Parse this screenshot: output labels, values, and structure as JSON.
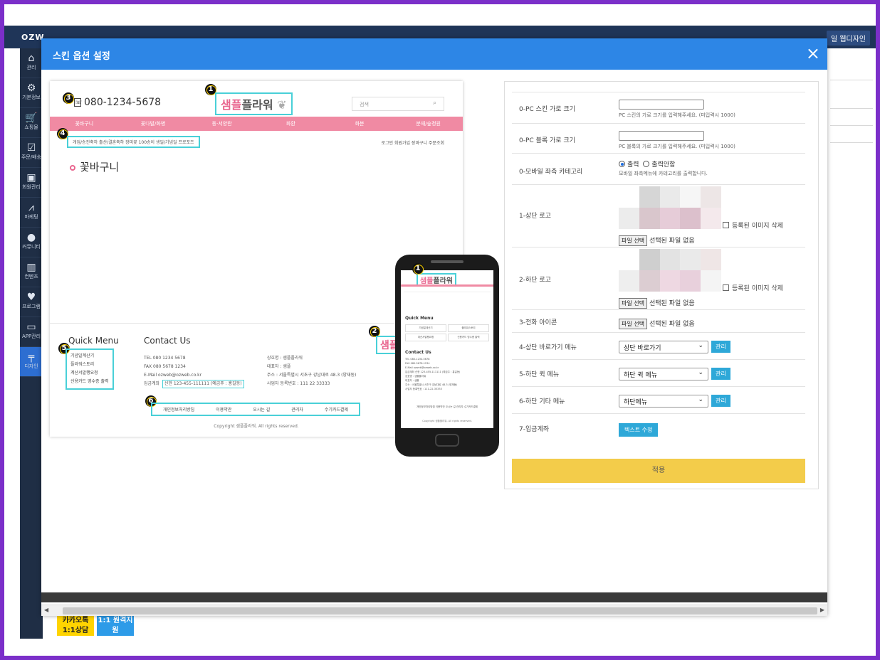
{
  "app": {
    "logo": "OZW",
    "top_right_button": "일 웹디자인"
  },
  "sidebar": {
    "items": [
      {
        "icon": "home-icon",
        "label": "관리"
      },
      {
        "icon": "gear-icon",
        "label": "기본정보"
      },
      {
        "icon": "cart-icon",
        "label": "쇼핑몰"
      },
      {
        "icon": "order-icon",
        "label": "주문/배송"
      },
      {
        "icon": "member-icon",
        "label": "회원관리"
      },
      {
        "icon": "chart-icon",
        "label": "마케팅"
      },
      {
        "icon": "chat-icon",
        "label": "커뮤니티"
      },
      {
        "icon": "content-icon",
        "label": "컨텐츠"
      },
      {
        "icon": "heart-icon",
        "label": "프로그램"
      },
      {
        "icon": "app-icon",
        "label": "APP관리"
      },
      {
        "icon": "design-icon",
        "label": "디자인"
      }
    ]
  },
  "bottom_buttons": {
    "consult": "카카오톡 1:1상담",
    "remote": "1:1 원격지원"
  },
  "modal": {
    "title": "스킨 옵션 설정",
    "close": "×"
  },
  "preview": {
    "phone_number": "080-1234-5678",
    "brand_part1": "샘플",
    "brand_part2": "플라워",
    "search_placeholder": "검색",
    "nav": [
      "꽃바구니",
      "꽃다발/화병",
      "동·서양란",
      "화환",
      "화분",
      "분재/숲정원"
    ],
    "subnav": "개업/승진축하   출산/결혼축하   장미꽃 100송이   생일/기념일   프로포즈",
    "subnav_right": "로그인   회원가입   장바구니   주문조회",
    "page_heading": "꽃바구니",
    "quick_menu_title": "Quick Menu",
    "quick_menu_items": [
      "기념일계산기",
      "플라워스토리",
      "계산서발행요청",
      "신용카드 영수증 출력"
    ],
    "contact_title": "Contact Us",
    "contact_left": [
      "TEL      080 1234 5678",
      "FAX      080 5678 1234",
      "E-Mail   ozweb@ozweb.co.kr"
    ],
    "bank_label": "입금계좌",
    "bank_value": "신한 123-455-111111 (예금주 : 홍길동)",
    "contact_right": [
      "상호명 : 샘플플라워",
      "대표자 : 샘플",
      "주소 : 서울특별시 서초구 강남대로 48.3 (양재동)",
      "사업자 등록번호 : 111 22 33333"
    ],
    "footer_links": [
      "개인정보처리방침",
      "이용약관",
      "오시는 길",
      "관리자",
      "수기카드결제"
    ],
    "copyright": "Copyright 샘플플라워. All rights reserved.",
    "brand2": "샘플",
    "badges": [
      "1",
      "2",
      "3",
      "4",
      "5",
      "6",
      "1"
    ]
  },
  "mobile": {
    "brand_part1": "샘플",
    "brand_part2": "플라워",
    "quick_menu_title": "Quick Menu",
    "quick_items": [
      "기념일계산기",
      "플라워스토리",
      "계산서발행요청",
      "신용카드 영수증 출력"
    ],
    "contact_title": "Contact Us",
    "info": [
      "TEL    080-1234-5678",
      "FAX    080-5678-1234",
      "E-Mail   ozweb@ozweb.co.kr",
      "입금계좌  신한 123-455-111111 (예금주 : 홍길동)",
      "상호명 : 샘플플라워",
      "대표자 : 샘플",
      "주소 : 서울특별시 서초구 강남대로 48.3 (양재동)",
      "사업자 등록번호 : 111-22-33333"
    ],
    "links": "개인정보처리방침   이용약관   오시는 길   관리자   수기카드결제",
    "copyright": "Copyright 샘플플라워. All rights reserved."
  },
  "settings": {
    "rows": {
      "pc_skin_width": {
        "label": "0-PC 스킨 가로 크기",
        "value": "",
        "help": "PC 스킨의 가로 크기를 입력해주세요. (미입력시 1000)"
      },
      "pc_block_width": {
        "label": "0-PC 블록 가로 크기",
        "value": "",
        "help": "PC 블록의 가로 크기를 입력해주세요. (미입력시 1000)"
      },
      "mobile_category": {
        "label": "0-모바일 좌측 카테고리",
        "opt_on": "출력",
        "opt_off": "출력안함",
        "selected": "출력",
        "help": "모바일 좌측메뉴에 카테고리를 출력합니다."
      },
      "top_logo": {
        "label": "1-상단 로고",
        "file_button": "파일 선택",
        "file_status": "선택된 파일 없음",
        "delete_label": "등록된 이미지 삭제"
      },
      "bottom_logo": {
        "label": "2-하단 로고",
        "file_button": "파일 선택",
        "file_status": "선택된 파일 없음",
        "delete_label": "등록된 이미지 삭제"
      },
      "phone_icon": {
        "label": "3-전화 아이콘",
        "file_button": "파일 선택",
        "file_status": "선택된 파일 없음"
      },
      "top_shortcut": {
        "label": "4-상단 바로가기 메뉴",
        "select_value": "상단 바로가기",
        "manage": "관리"
      },
      "bottom_quick": {
        "label": "5-하단 퀵 메뉴",
        "select_value": "하단 퀵 메뉴",
        "manage": "관리"
      },
      "bottom_etc": {
        "label": "6-하단 기타 메뉴",
        "select_value": "하단메뉴",
        "manage": "관리"
      },
      "deposit": {
        "label": "7-입금계좌",
        "edit_button": "텍스트 수정"
      }
    },
    "apply_button": "적용"
  },
  "colors": {
    "header_blue": "#2d86e6",
    "brand_pink": "#e9668f",
    "nav_pink": "#f08aa3",
    "highlight_cyan": "#49d0d8",
    "apply_yellow": "#f3cc4a",
    "manage_blue": "#2ea8d8"
  }
}
